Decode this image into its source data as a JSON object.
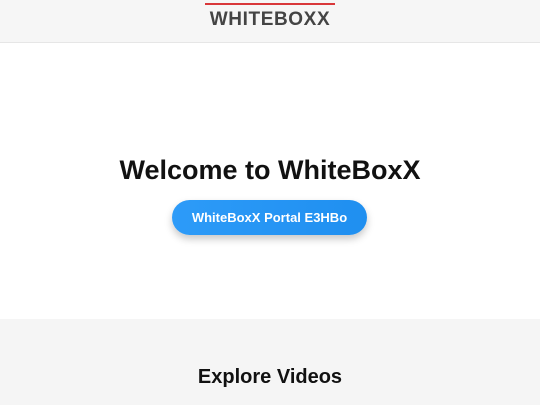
{
  "header": {
    "logo_text": "WHITEBOXX",
    "accent_color": "#d9383a"
  },
  "hero": {
    "title": "Welcome to WhiteBoxX",
    "portal_button_label": "WhiteBoxX Portal E3HBo",
    "button_color": "#2196f3"
  },
  "videos": {
    "title": "Explore Videos"
  }
}
